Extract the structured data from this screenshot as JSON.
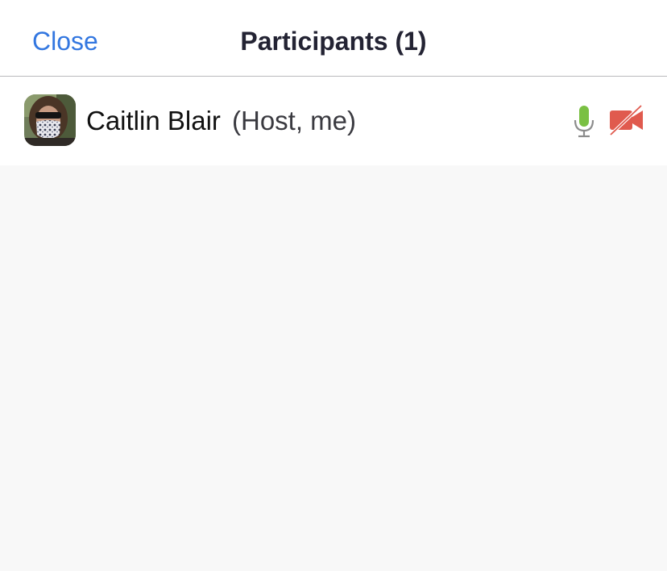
{
  "header": {
    "close_label": "Close",
    "title": "Participants (1)"
  },
  "participants": [
    {
      "name": "Caitlin Blair",
      "role": "(Host, me)",
      "audio_icon": "mic-unmuted-icon",
      "video_icon": "video-off-icon"
    }
  ],
  "colors": {
    "accent": "#3377e0",
    "mic_active": "#7ac043",
    "video_off": "#e05a4e"
  }
}
